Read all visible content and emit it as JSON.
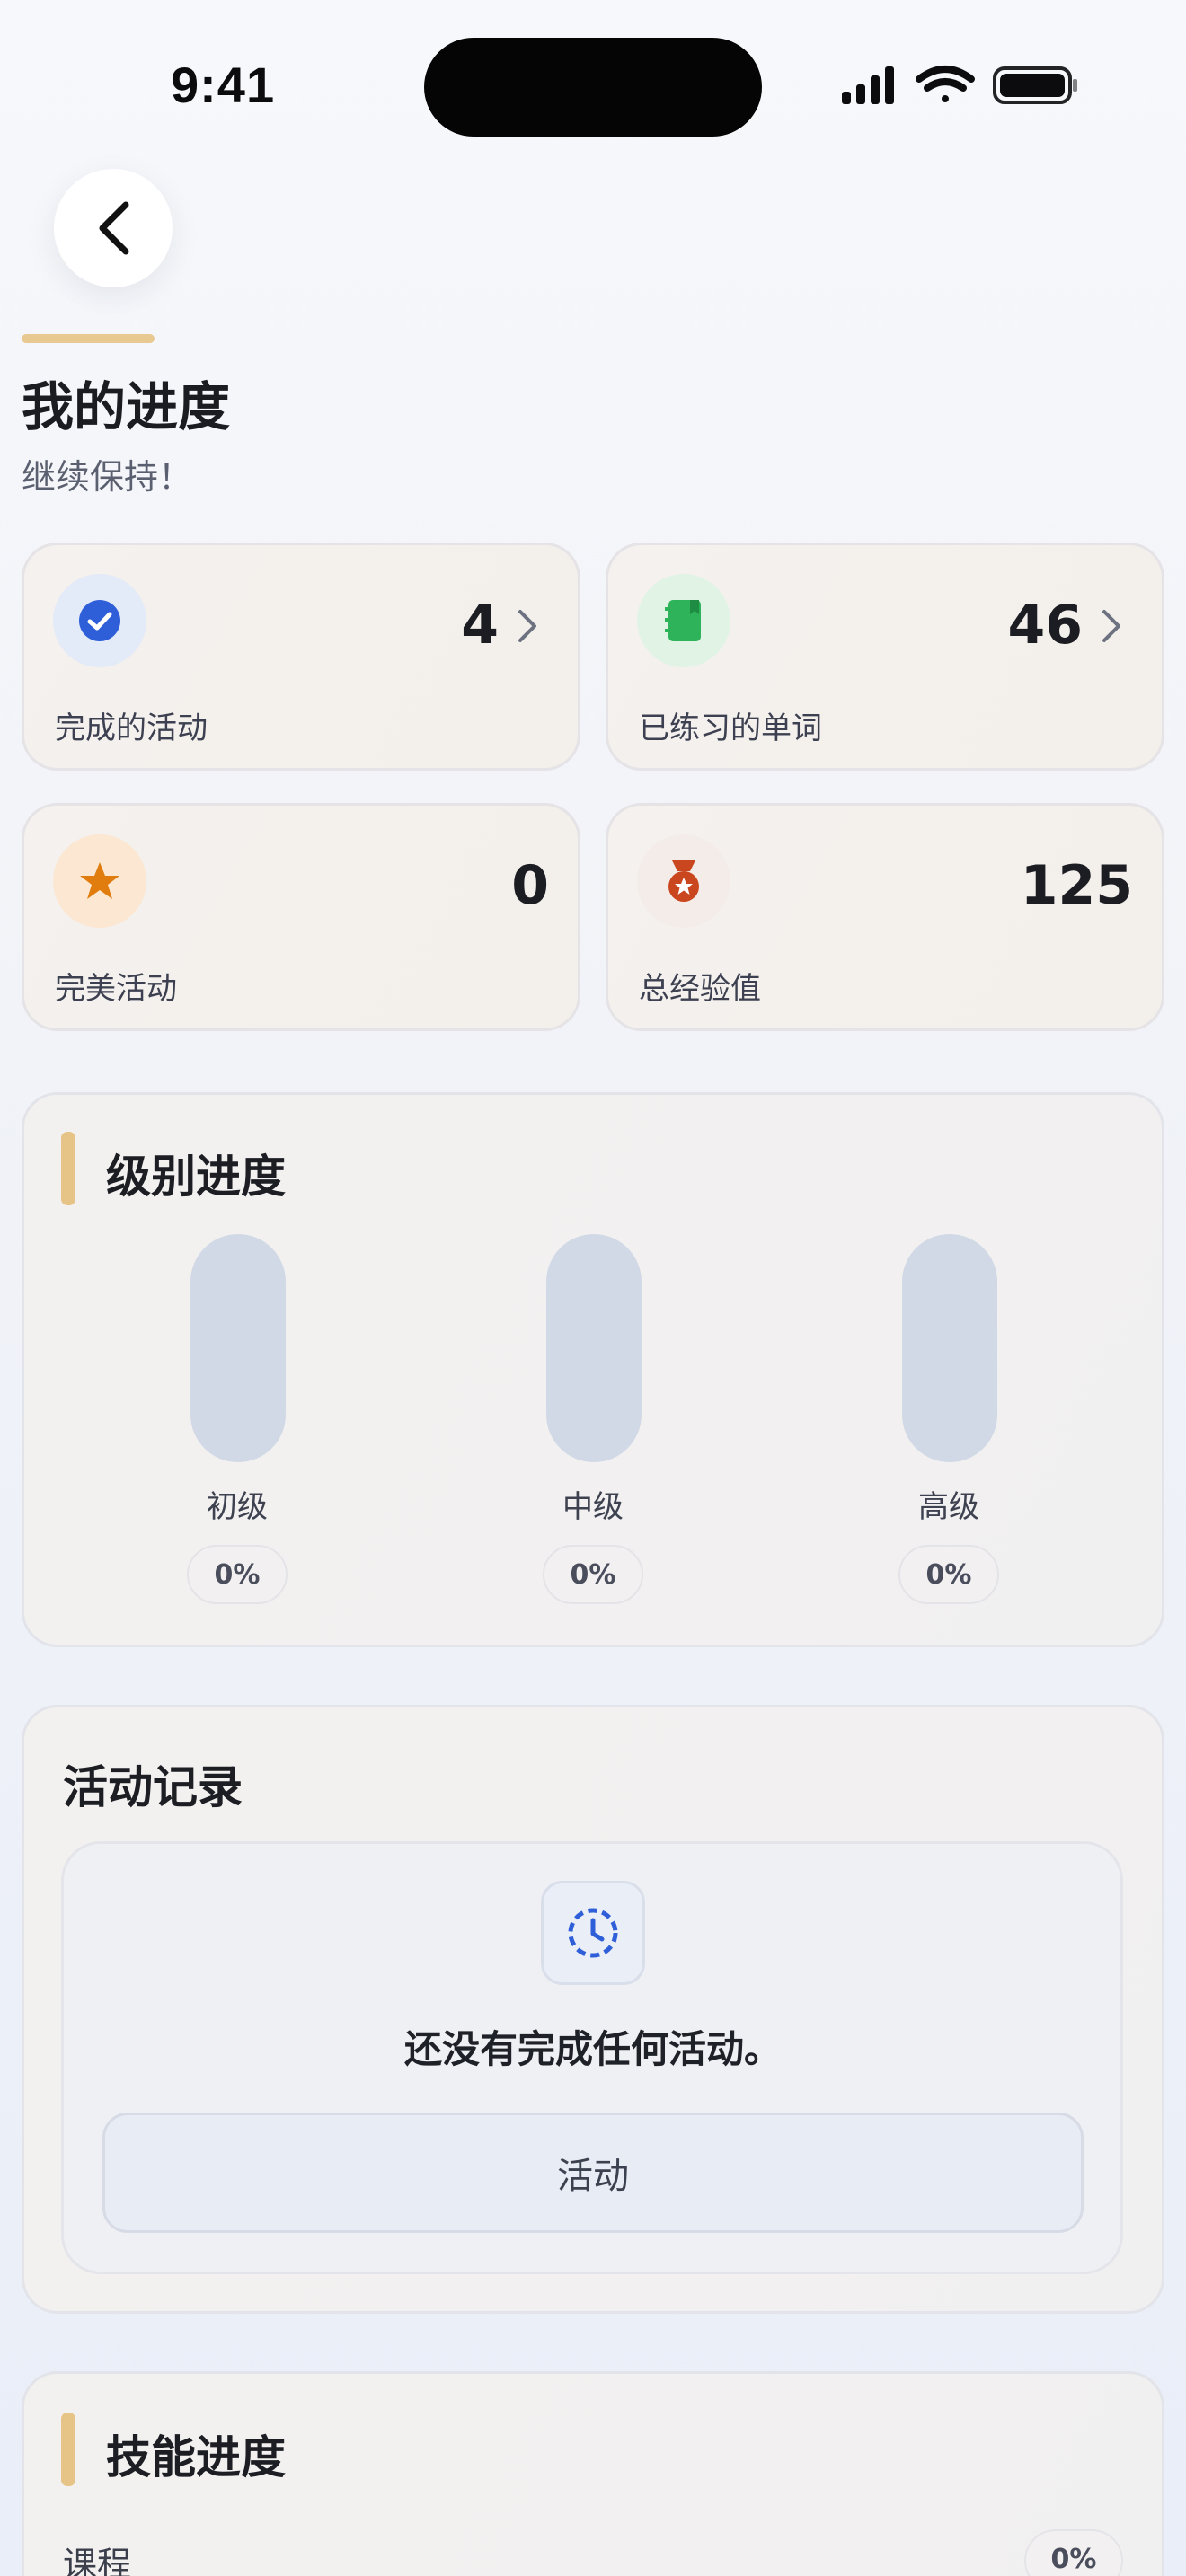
{
  "status_bar": {
    "time": "9:41"
  },
  "header": {
    "title": "我的进度",
    "subtitle": "继续保持！"
  },
  "stats": [
    {
      "label": "完成的活动",
      "value": "4",
      "icon": "check-circle-icon",
      "color": "#2f5fd8"
    },
    {
      "label": "已练习的单词",
      "value": "46",
      "icon": "notebook-icon",
      "color": "#2fb35a"
    },
    {
      "label": "完美活动",
      "value": "0",
      "icon": "star-icon",
      "color": "#e07d0e"
    },
    {
      "label": "总经验值",
      "value": "125",
      "icon": "medal-icon",
      "color": "#c9461e"
    }
  ],
  "level_progress": {
    "title": "级别进度",
    "levels": [
      {
        "name": "初级",
        "percent": "0%"
      },
      {
        "name": "中级",
        "percent": "0%"
      },
      {
        "name": "高级",
        "percent": "0%"
      }
    ]
  },
  "activity_history": {
    "title": "活动记录",
    "empty_message": "还没有完成任何活动。",
    "button_label": "活动",
    "icon": "clock-icon"
  },
  "skill_progress": {
    "title": "技能进度",
    "items": [
      {
        "name": "课程",
        "percent": "0%"
      }
    ]
  },
  "colors": {
    "accent": "#e6c487",
    "primary_blue": "#2f5fd8"
  }
}
